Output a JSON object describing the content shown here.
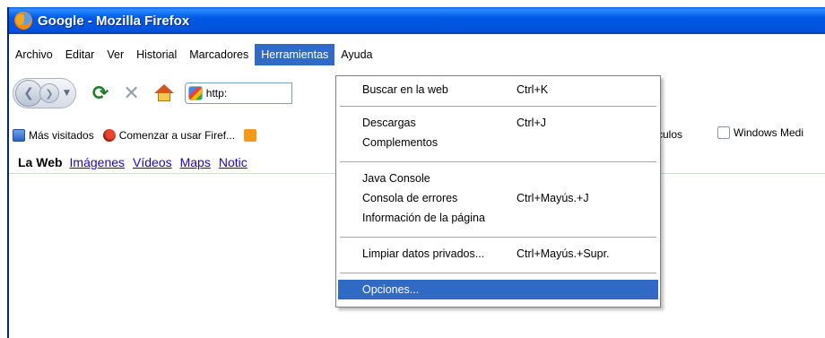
{
  "window": {
    "title": "Google - Mozilla Firefox"
  },
  "menubar": {
    "items": [
      {
        "label": "Archivo"
      },
      {
        "label": "Editar"
      },
      {
        "label": "Ver"
      },
      {
        "label": "Historial"
      },
      {
        "label": "Marcadores"
      },
      {
        "label": "Herramientas"
      },
      {
        "label": "Ayuda"
      }
    ],
    "active": "Herramientas"
  },
  "navbar": {
    "url_text": "http:",
    "icons": [
      "back-icon",
      "forward-icon",
      "history-dropdown-icon",
      "reload-icon",
      "stop-icon",
      "home-icon",
      "site-favicon"
    ]
  },
  "bookmarks": {
    "items": [
      {
        "label": "Más visitados",
        "icon": "star-icon"
      },
      {
        "label": "Comenzar a usar Firef...",
        "icon": "firefox-icon"
      },
      {
        "label": "",
        "icon": "rss-icon"
      },
      {
        "label": "vínculos",
        "icon": ""
      },
      {
        "label": "Windows Medi",
        "icon": "page-icon"
      }
    ]
  },
  "google_bar": {
    "title": "La Web",
    "links": [
      "Imágenes",
      "Vídeos",
      "Maps",
      "Notic"
    ]
  },
  "tools_menu": {
    "items": [
      {
        "label": "Buscar en la web",
        "shortcut": "Ctrl+K"
      },
      {
        "label": "Descargas",
        "shortcut": "Ctrl+J"
      },
      {
        "label": "Complementos",
        "shortcut": ""
      },
      {
        "label": "Java Console",
        "shortcut": ""
      },
      {
        "label": "Consola de errores",
        "shortcut": "Ctrl+Mayús.+J"
      },
      {
        "label": "Información de la página",
        "shortcut": ""
      },
      {
        "label": "Limpiar datos privados...",
        "shortcut": "Ctrl+Mayús.+Supr."
      },
      {
        "label": "Opciones...",
        "shortcut": ""
      }
    ],
    "selected": "Opciones..."
  },
  "colors": {
    "titlebar": "#0054d8",
    "selection": "#316ac5",
    "link": "#2200cc"
  }
}
